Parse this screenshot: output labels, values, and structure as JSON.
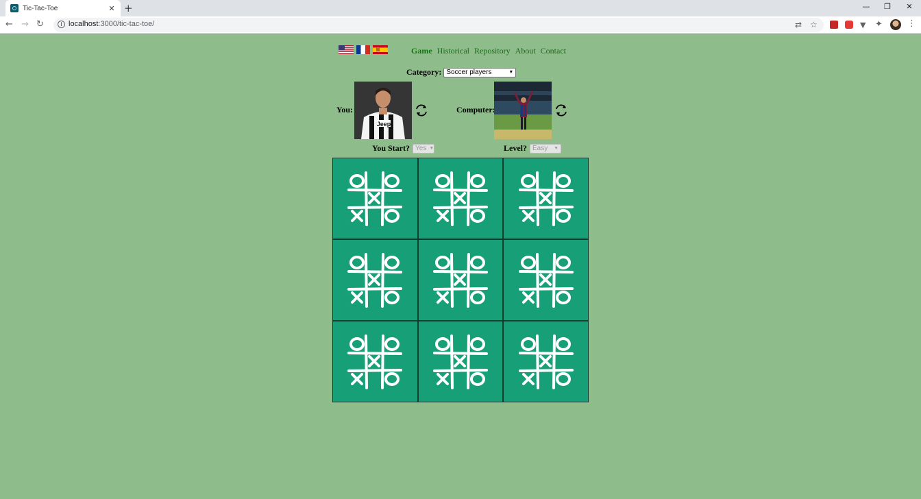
{
  "browser": {
    "tab_title": "Tic-Tac-Toe",
    "url_host": "localhost",
    "url_rest": ":3000/tic-tac-toe/"
  },
  "languages": [
    {
      "name": "us-flag-icon"
    },
    {
      "name": "fr-flag-icon"
    },
    {
      "name": "es-flag-icon"
    }
  ],
  "nav": {
    "items": [
      "Game",
      "Historical",
      "Repository",
      "About",
      "Contact"
    ],
    "active": "Game"
  },
  "category": {
    "label": "Category:",
    "selected": "Soccer players"
  },
  "players": {
    "you_label": "You:",
    "computer_label": "Computer:"
  },
  "options": {
    "start_label": "You Start?",
    "start_value": "Yes",
    "level_label": "Level?",
    "level_value": "Easy"
  },
  "colors": {
    "page_bg": "#8fbc8b",
    "cell_bg": "#17a077",
    "nav_link": "#1a6b1a"
  },
  "board": {
    "rows": 3,
    "cols": 3,
    "cell_icon": "tic-tac-toe-icon"
  }
}
